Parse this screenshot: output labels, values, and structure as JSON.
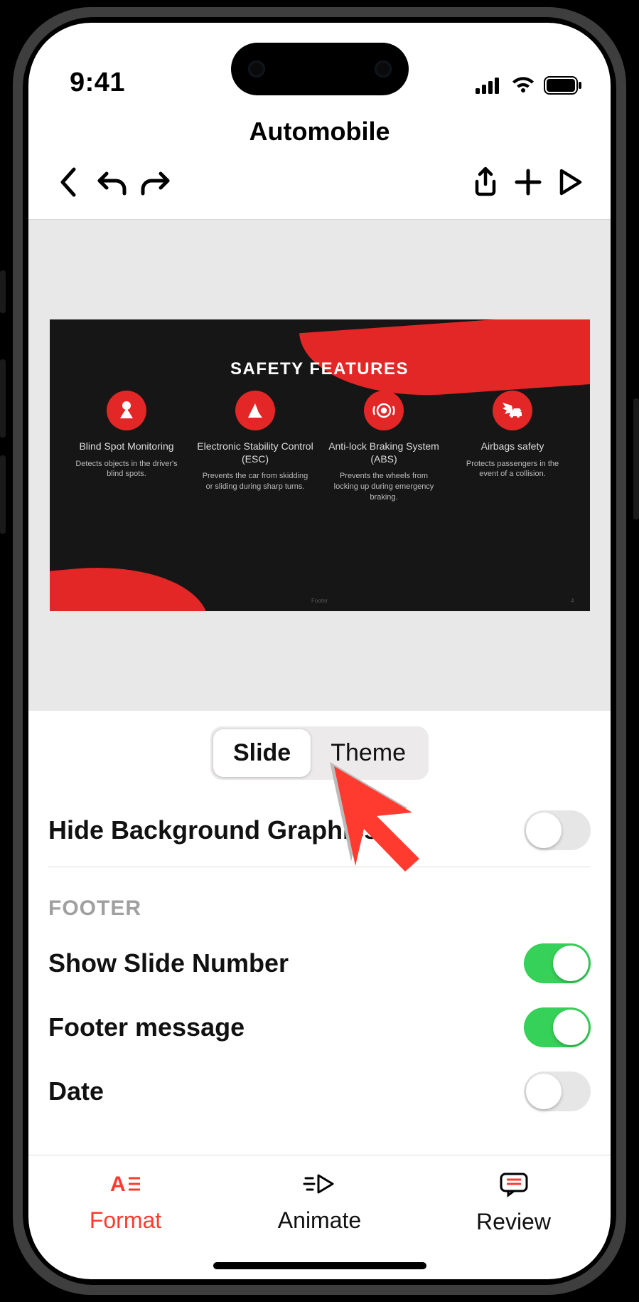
{
  "status": {
    "time": "9:41"
  },
  "header": {
    "title": "Automobile"
  },
  "slide": {
    "title": "SAFETY FEATURES",
    "footer": "Footer",
    "number": "4",
    "features": [
      {
        "title": "Blind Spot Monitoring",
        "desc": "Detects objects in the driver's blind spots."
      },
      {
        "title": "Electronic Stability Control (ESC)",
        "desc": "Prevents the car from skidding or sliding during sharp turns."
      },
      {
        "title": "Anti-lock Braking System (ABS)",
        "desc": "Prevents the wheels from locking up during emergency braking."
      },
      {
        "title": "Airbags safety",
        "desc": "Protects passengers in the event of a collision."
      }
    ]
  },
  "segmented": {
    "slide": "Slide",
    "theme": "Theme"
  },
  "settings": {
    "hide_bg": "Hide Background Graphics",
    "footer_section": "FOOTER",
    "show_slide_number": "Show Slide Number",
    "footer_message": "Footer message",
    "date": "Date"
  },
  "tabs": {
    "format": "Format",
    "animate": "Animate",
    "review": "Review"
  }
}
